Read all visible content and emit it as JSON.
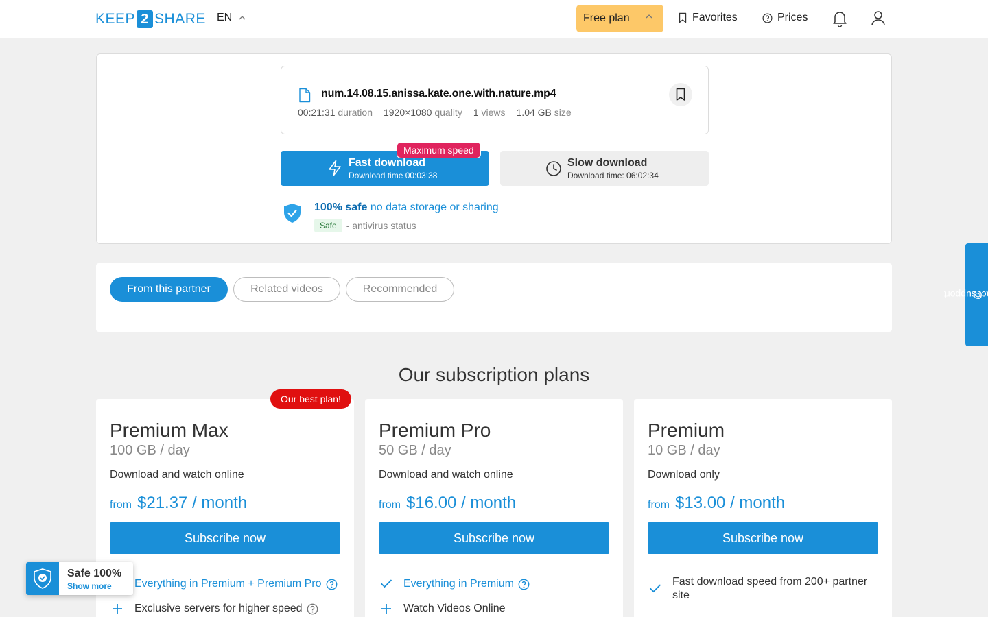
{
  "header": {
    "logo_left": "KEEP",
    "logo_num": "2",
    "logo_right": "SHARE",
    "language": "EN",
    "plan_label": "Free plan",
    "favorites_label": "Favorites",
    "prices_label": "Prices"
  },
  "file": {
    "name": "num.14.08.15.anissa.kate.one.with.nature.mp4",
    "duration_value": "00:21:31",
    "duration_label": "duration",
    "quality_value": "1920×1080",
    "quality_label": "quality",
    "views_value": "1",
    "views_label": "views",
    "size_value": "1.04 GB",
    "size_label": "size"
  },
  "download": {
    "fast_title": "Fast download",
    "fast_subtitle": "Download time 00:03:38",
    "speed_badge": "Maximum speed",
    "slow_title": "Slow download",
    "slow_subtitle": "Download time: 06:02:34"
  },
  "safety": {
    "bold": "100% safe",
    "rest": "no data storage or sharing",
    "tag": "Safe",
    "status": "- antivirus status"
  },
  "tabs": [
    {
      "label": "From this partner",
      "active": true
    },
    {
      "label": "Related videos",
      "active": false
    },
    {
      "label": "Recommended",
      "active": false
    }
  ],
  "support_label": "contact support",
  "plans_title": "Our subscription plans",
  "plans": [
    {
      "name": "Premium Max",
      "quota": "100 GB / day",
      "desc": "Download and watch online",
      "from": "from",
      "price": "$21.37 / month",
      "button": "Subscribe now",
      "badge": "Our best plan!",
      "features": [
        "Everything in Premium + Premium Pro",
        "Exclusive servers for higher speed"
      ]
    },
    {
      "name": "Premium Pro",
      "quota": "50 GB / day",
      "desc": "Download and watch online",
      "from": "from",
      "price": "$16.00 / month",
      "button": "Subscribe now",
      "features": [
        "Everything in Premium",
        "Watch Videos Online"
      ]
    },
    {
      "name": "Premium",
      "quota": "10 GB / day",
      "desc": "Download only",
      "from": "from",
      "price": "$13.00 / month",
      "button": "Subscribe now",
      "features": [
        "Fast download speed from 200+ partner site"
      ]
    }
  ],
  "safe_widget": {
    "title": "Safe 100%",
    "link": "Show more"
  },
  "colors": {
    "accent": "#1a8fd8",
    "plan_button": "#fdc868",
    "speed_badge": "#e0245e",
    "best_badge": "#e01010"
  }
}
